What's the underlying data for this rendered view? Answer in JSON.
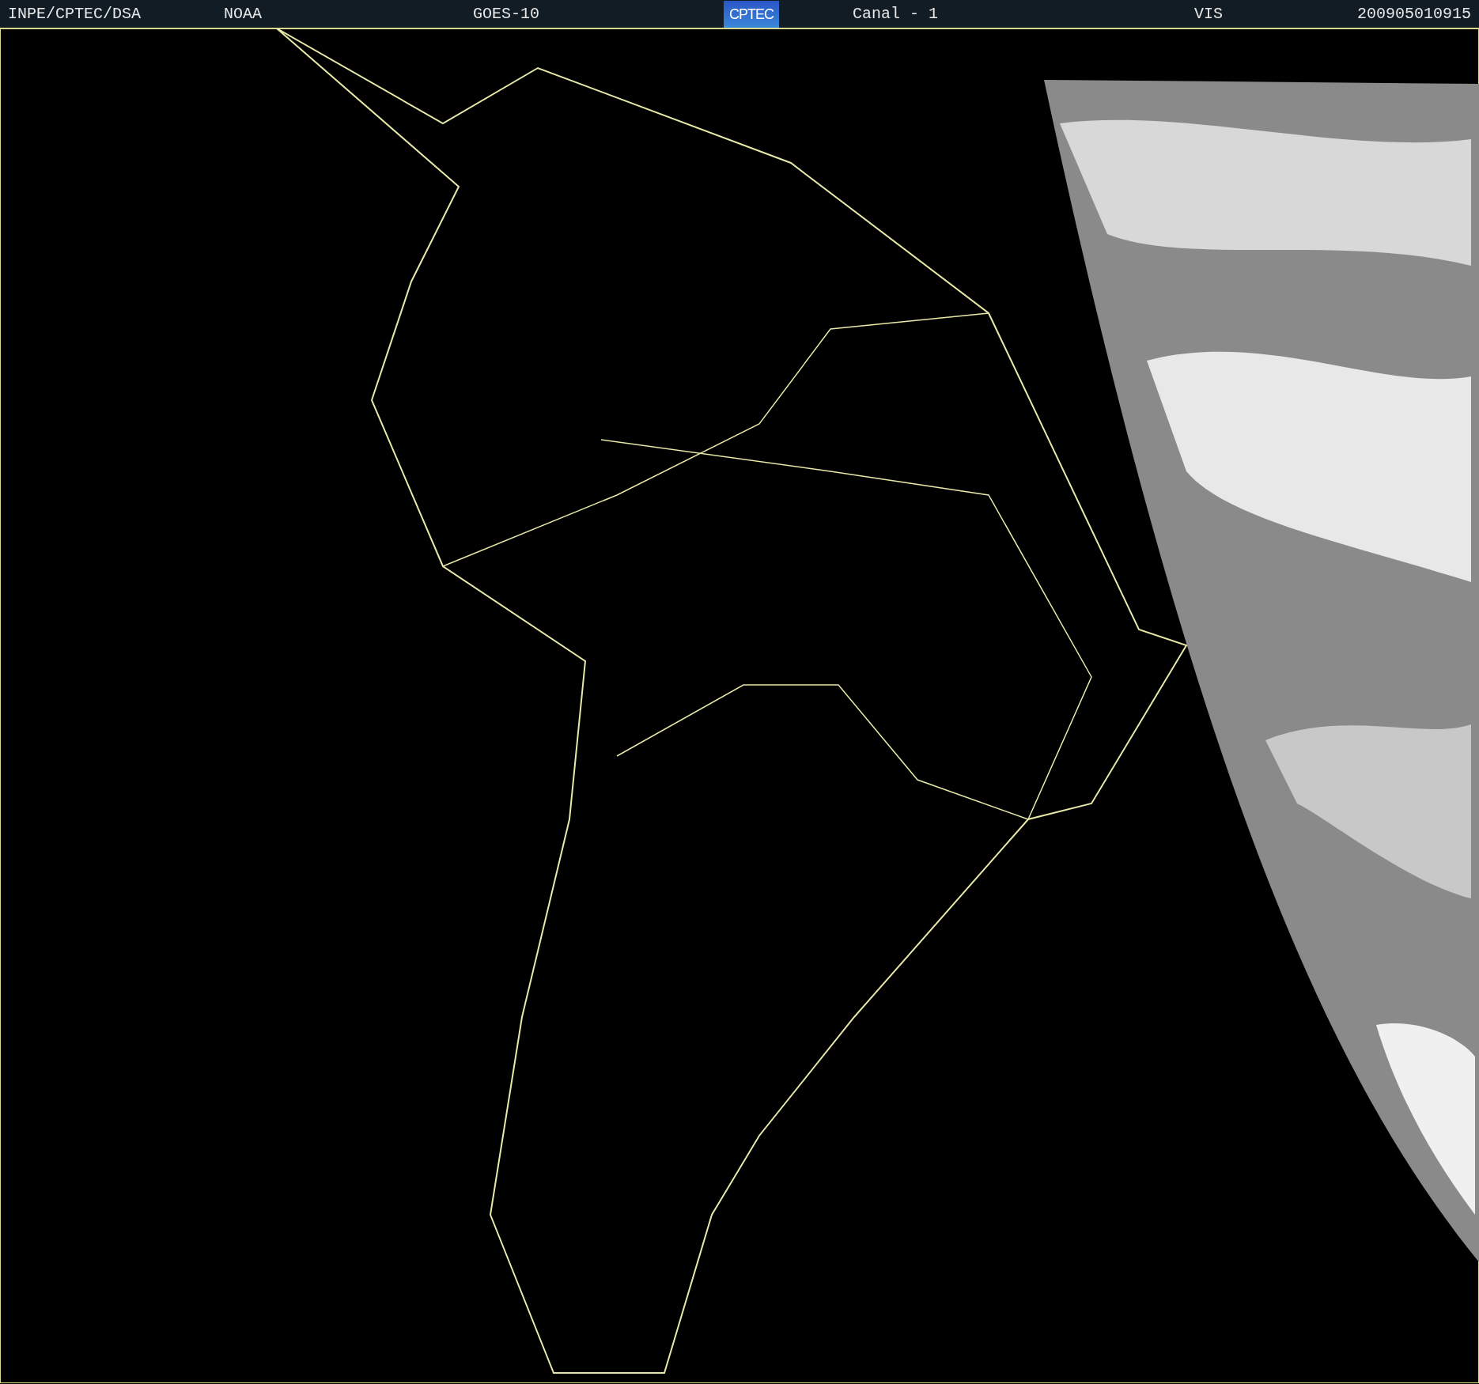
{
  "header": {
    "items": [
      {
        "kind": "text",
        "text": "INPE/CPTEC/DSA"
      },
      {
        "kind": "text",
        "text": "NOAA"
      },
      {
        "kind": "text",
        "text": "GOES-10"
      },
      {
        "kind": "logo",
        "text": "CPTEC"
      },
      {
        "kind": "text",
        "text": "Canal - 1"
      },
      {
        "kind": "text",
        "text": "VIS"
      },
      {
        "kind": "text",
        "text": "200905010915"
      }
    ]
  }
}
